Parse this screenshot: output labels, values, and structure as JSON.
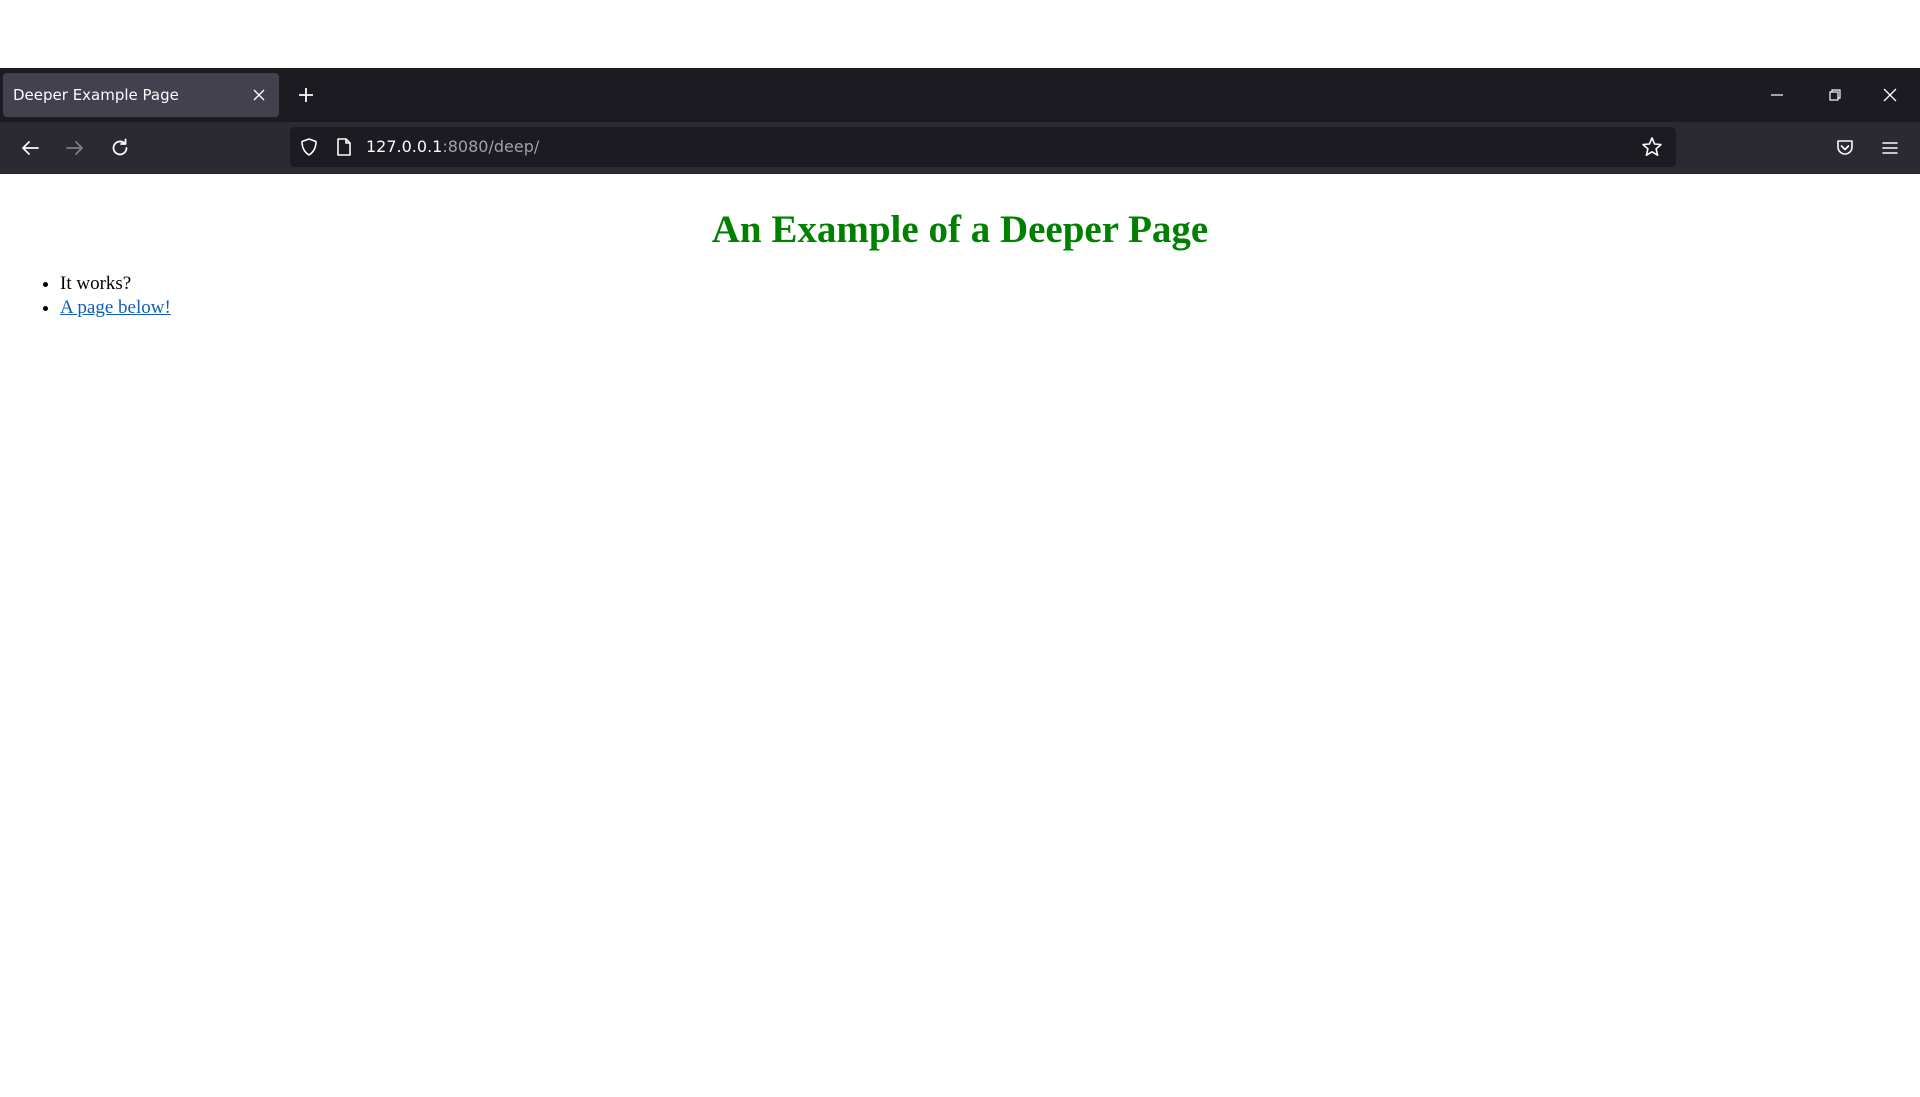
{
  "browser": {
    "tab": {
      "title": "Deeper Example Page"
    },
    "address": {
      "host": "127.0.0.1",
      "path": ":8080/deep/"
    },
    "colors": {
      "tabbar_bg": "#1c1b22",
      "navbar_bg": "#2b2a33",
      "active_tab_bg": "#42414d"
    },
    "icons": {
      "tab_close": "close-icon",
      "new_tab": "plus-icon",
      "minimize": "minimize-icon",
      "restore": "restore-icon",
      "close_window": "close-icon",
      "back": "arrow-left-icon",
      "forward": "arrow-right-icon",
      "reload": "reload-icon",
      "shield": "shield-icon",
      "page": "page-icon",
      "bookmark": "star-icon",
      "pocket": "pocket-icon",
      "menu": "hamburger-icon"
    }
  },
  "page": {
    "title": "An Example of a Deeper Page",
    "title_color": "#008000",
    "items": [
      {
        "text": "It works?"
      },
      {
        "link_text": "A page below!"
      }
    ],
    "link_color": "#0b5fb8"
  }
}
